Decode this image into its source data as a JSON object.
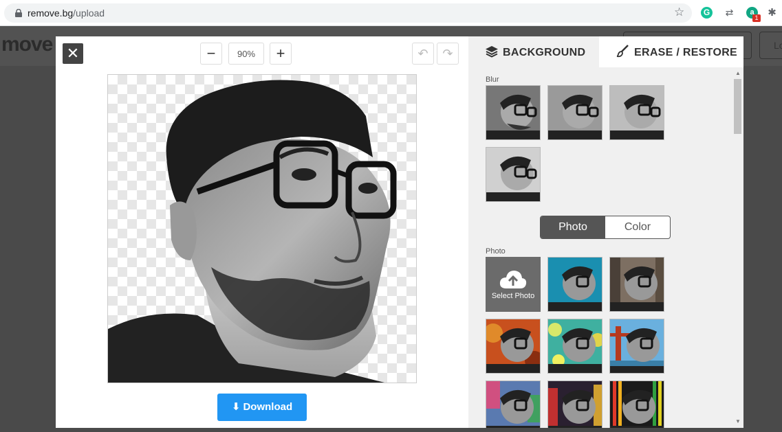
{
  "browser": {
    "url_host": "remove.bg",
    "url_path": "/upload",
    "ext_badge": "1"
  },
  "page": {
    "logo_partial": "move",
    "header_btn2": "Lo"
  },
  "editor": {
    "zoom_value": "90%",
    "download_label": "Download"
  },
  "panel": {
    "tabs": [
      {
        "label": "BACKGROUND"
      },
      {
        "label": "ERASE / RESTORE"
      }
    ],
    "blur_label": "Blur",
    "toggle": {
      "photo": "Photo",
      "color": "Color"
    },
    "photo_label": "Photo",
    "select_photo_label": "Select Photo"
  },
  "colors": {
    "accent": "#2196f3",
    "toggle_active": "#555555"
  }
}
